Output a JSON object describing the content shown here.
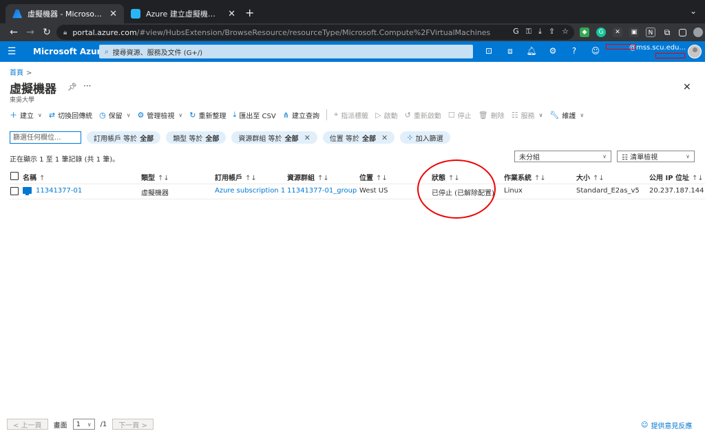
{
  "browser": {
    "tabs": [
      {
        "title": "虛擬機器 - Microsoft Azure",
        "favicon": "azure-icon"
      },
      {
        "title": "Azure 建立虛擬機器 - iT 邦幫忙...",
        "favicon": "ithome-icon"
      }
    ],
    "url_host": "portal.azure.com",
    "url_path": "/#view/HubsExtension/BrowseResource/resourceType/Microsoft.Compute%2FVirtualMachines"
  },
  "azure": {
    "brand": "Microsoft Azure",
    "search_placeholder": "搜尋資源、服務及文件 (G+/)",
    "account_email": "@mss.scu.edu..."
  },
  "page": {
    "breadcrumb_home": "首頁",
    "title": "虛擬機器",
    "subtitle": "東吳大學"
  },
  "toolbar": [
    {
      "label": "建立",
      "icon": "plus-icon",
      "chevron": true,
      "disabled": false
    },
    {
      "label": "切換回傳統",
      "icon": "switch-icon",
      "chevron": false,
      "disabled": false
    },
    {
      "label": "保留",
      "icon": "clock-icon",
      "chevron": true,
      "disabled": false
    },
    {
      "label": "管理檢視",
      "icon": "gear-icon",
      "chevron": true,
      "disabled": false
    },
    {
      "label": "重新整理",
      "icon": "refresh-icon",
      "chevron": false,
      "disabled": false
    },
    {
      "label": "匯出至 CSV",
      "icon": "download-icon",
      "chevron": false,
      "disabled": false
    },
    {
      "label": "建立查詢",
      "icon": "query-icon",
      "chevron": false,
      "disabled": false
    },
    {
      "label": "指派標籤",
      "icon": "tag-icon",
      "chevron": false,
      "disabled": true
    },
    {
      "label": "啟動",
      "icon": "play-icon",
      "chevron": false,
      "disabled": true
    },
    {
      "label": "重新啟動",
      "icon": "restart-icon",
      "chevron": false,
      "disabled": true
    },
    {
      "label": "停止",
      "icon": "stop-icon",
      "chevron": false,
      "disabled": true
    },
    {
      "label": "刪除",
      "icon": "trash-icon",
      "chevron": false,
      "disabled": true
    },
    {
      "label": "服務",
      "icon": "list-icon",
      "chevron": true,
      "disabled": true
    },
    {
      "label": "維護",
      "icon": "wrench-icon",
      "chevron": true,
      "disabled": false
    }
  ],
  "filters": {
    "input_placeholder": "篩選任何欄位...",
    "pills": [
      {
        "field": "訂用帳戶 等於",
        "value": "全部",
        "removable": false
      },
      {
        "field": "類型 等於",
        "value": "全部",
        "removable": false
      },
      {
        "field": "資源群組 等於",
        "value": "全部",
        "removable": true
      },
      {
        "field": "位置 等於",
        "value": "全部",
        "removable": true
      }
    ],
    "add_label": "加入篩選"
  },
  "records_text": "正在顯示 1 至 1 筆記錄 (共 1 筆)。",
  "grouping": "未分組",
  "view": "清單檢視",
  "table": {
    "columns": [
      "名稱",
      "類型",
      "訂用帳戶",
      "資源群組",
      "位置",
      "狀態",
      "作業系統",
      "大小",
      "公用 IP 位址"
    ],
    "rows": [
      {
        "name": "11341377-01",
        "type": "虛擬機器",
        "subscription": "Azure subscription 1",
        "resource_group": "11341377-01_group",
        "location": "West US",
        "status": "已停止 (已解除配置)",
        "os": "Linux",
        "size": "Standard_E2as_v5",
        "public_ip": "20.237.187.144"
      }
    ]
  },
  "pager": {
    "prev": "< 上一頁",
    "page_label": "畫面",
    "page": "1",
    "total": "/1",
    "next": "下一頁 >"
  },
  "feedback": "提供意見反應",
  "annotation_color": "#e00000"
}
